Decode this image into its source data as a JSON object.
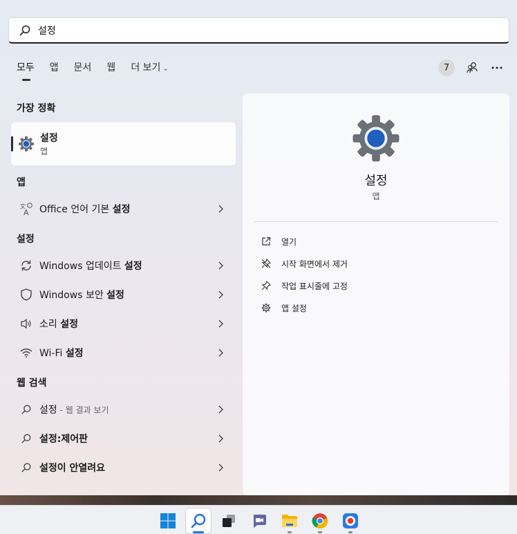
{
  "search": {
    "query": "설정"
  },
  "tabs": [
    {
      "label": "모두"
    },
    {
      "label": "앱"
    },
    {
      "label": "문서"
    },
    {
      "label": "웹"
    },
    {
      "label": "더 보기"
    }
  ],
  "toolbar": {
    "count": "7"
  },
  "sections": {
    "best_match": "가장 정확",
    "apps": "앱",
    "settings": "설정",
    "web": "웹 검색"
  },
  "best_match": {
    "title": "설정",
    "subtitle": "앱"
  },
  "apps": [
    {
      "prefix": "Office 언어 기본 ",
      "bold": "설정"
    }
  ],
  "settings": [
    {
      "prefix": "Windows 업데이트 ",
      "bold": "설정",
      "icon": "refresh-icon"
    },
    {
      "prefix": "Windows 보안 ",
      "bold": "설정",
      "icon": "shield-icon"
    },
    {
      "prefix": "소리 ",
      "bold": "설정",
      "icon": "speaker-icon"
    },
    {
      "prefix": "Wi-Fi ",
      "bold": "설정",
      "icon": "wifi-icon"
    }
  ],
  "web": [
    {
      "main": "설정",
      "sub": " - 웹 결과 보기"
    },
    {
      "main": "설정:제어판",
      "sub": ""
    },
    {
      "main": "설정이 안열려요",
      "sub": ""
    }
  ],
  "detail": {
    "title": "설정",
    "subtitle": "앱",
    "actions": [
      {
        "label": "열기",
        "icon": "open-external-icon"
      },
      {
        "label": "시작 화면에서 제거",
        "icon": "unpin-icon"
      },
      {
        "label": "작업 표시줄에 고정",
        "icon": "pin-icon"
      },
      {
        "label": "앱 설정",
        "icon": "gear-icon"
      }
    ]
  },
  "taskbar": [
    {
      "name": "start-button",
      "icon": "windows-logo-icon"
    },
    {
      "name": "search-button",
      "icon": "search-icon"
    },
    {
      "name": "task-view-button",
      "icon": "task-view-icon"
    },
    {
      "name": "chat-button",
      "icon": "chat-icon"
    },
    {
      "name": "file-explorer-button",
      "icon": "folder-icon"
    },
    {
      "name": "chrome-button",
      "icon": "chrome-icon"
    },
    {
      "name": "recorder-button",
      "icon": "record-icon"
    }
  ],
  "colors": {
    "accent": "#1a73e8",
    "panel": "#f7f7fa"
  }
}
